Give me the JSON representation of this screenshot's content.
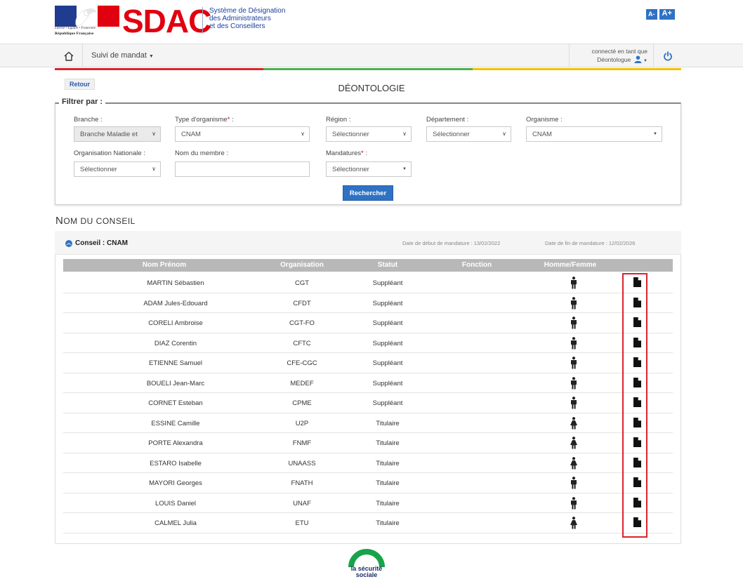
{
  "header": {
    "motto": "Liberté • Égalité • Fraternité",
    "republic": "République Française",
    "app_title": "SDAC",
    "subtitle_lines": [
      "Système de Désignation",
      "des Administrateurs",
      "et des Conseillers"
    ],
    "font_small": "A-",
    "font_large": "A+"
  },
  "nav": {
    "menu_label": "Suivi de mandat",
    "connected_as": "connecté en tant que",
    "role": "Déontologue"
  },
  "page": {
    "back_label": "Retour",
    "title": "DÉONTOLOGIE"
  },
  "filters": {
    "legend": "Filtrer par :",
    "branche": {
      "label": "Branche :",
      "value": "Branche Maladie et"
    },
    "type_org": {
      "label": "Type d'organisme",
      "required": "*",
      "suffix": " :",
      "value": "CNAM"
    },
    "region": {
      "label": "Région :",
      "value": "Sélectionner"
    },
    "departement": {
      "label": "Département :",
      "value": "Sélectionner"
    },
    "organisme": {
      "label": "Organisme :",
      "value": "CNAM"
    },
    "org_nationale": {
      "label": "Organisation Nationale :",
      "value": "Sélectionner"
    },
    "nom_membre": {
      "label": "Nom du membre :",
      "value": ""
    },
    "mandatures": {
      "label": "Mandatures",
      "required": "*",
      "suffix": " :",
      "value": "Sélectionner"
    },
    "search_label": "Rechercher"
  },
  "section": {
    "first": "N",
    "rest": "OM DU CONSEIL"
  },
  "conseil": {
    "label": "Conseil : CNAM",
    "date_debut": "Date de début de mandature : 13/02/2022",
    "date_fin": "Date de fin de mandature : 12/02/2026"
  },
  "table": {
    "columns": [
      "Nom Prénom",
      "Organisation",
      "Statut",
      "Fonction",
      "Homme/Femme"
    ],
    "rows": [
      {
        "name": "MARTIN  Sébastien",
        "org": "CGT",
        "statut": "Suppléant",
        "fonction": "",
        "gender": "male-icon"
      },
      {
        "name": "ADAM  Jules-Edouard",
        "org": "CFDT",
        "statut": "Suppléant",
        "fonction": "",
        "gender": "male-icon"
      },
      {
        "name": "CORELI  Ambroise",
        "org": "CGT-FO",
        "statut": "Suppléant",
        "fonction": "",
        "gender": "male-icon"
      },
      {
        "name": "DIAZ  Corentin",
        "org": "CFTC",
        "statut": "Suppléant",
        "fonction": "",
        "gender": "male-icon"
      },
      {
        "name": "ETIENNE  Samuel",
        "org": "CFE-CGC",
        "statut": "Suppléant",
        "fonction": "",
        "gender": "male-icon"
      },
      {
        "name": "BOUELI  Jean-Marc",
        "org": "MEDEF",
        "statut": "Suppléant",
        "fonction": "",
        "gender": "male-icon"
      },
      {
        "name": "CORNET  Esteban",
        "org": "CPME",
        "statut": "Suppléant",
        "fonction": "",
        "gender": "male-icon"
      },
      {
        "name": "ESSINE  Camille",
        "org": "U2P",
        "statut": "Titulaire",
        "fonction": "",
        "gender": "female-icon"
      },
      {
        "name": "PORTE  Alexandra",
        "org": "FNMF",
        "statut": "Titulaire",
        "fonction": "",
        "gender": "female-icon"
      },
      {
        "name": "ESTARO  Isabelle",
        "org": "UNAASS",
        "statut": "Titulaire",
        "fonction": "",
        "gender": "female-icon"
      },
      {
        "name": "MAYORI  Georges",
        "org": "FNATH",
        "statut": "Titulaire",
        "fonction": "",
        "gender": "male-icon"
      },
      {
        "name": "LOUIS  Daniel",
        "org": "UNAF",
        "statut": "Titulaire",
        "fonction": "",
        "gender": "male-icon"
      },
      {
        "name": "CALMEL  Julia",
        "org": "ETU",
        "statut": "Titulaire",
        "fonction": "",
        "gender": "female-icon"
      }
    ]
  },
  "footer": {
    "logo_line1": "la sécurité",
    "logo_line2": "sociale"
  },
  "colors": {
    "accent": "#2f72c4",
    "sdac_red": "#e1000f",
    "highlight": "#d9232d",
    "bar_red": "#d9232d",
    "bar_green": "#4caf50",
    "bar_yellow": "#f2c300"
  }
}
